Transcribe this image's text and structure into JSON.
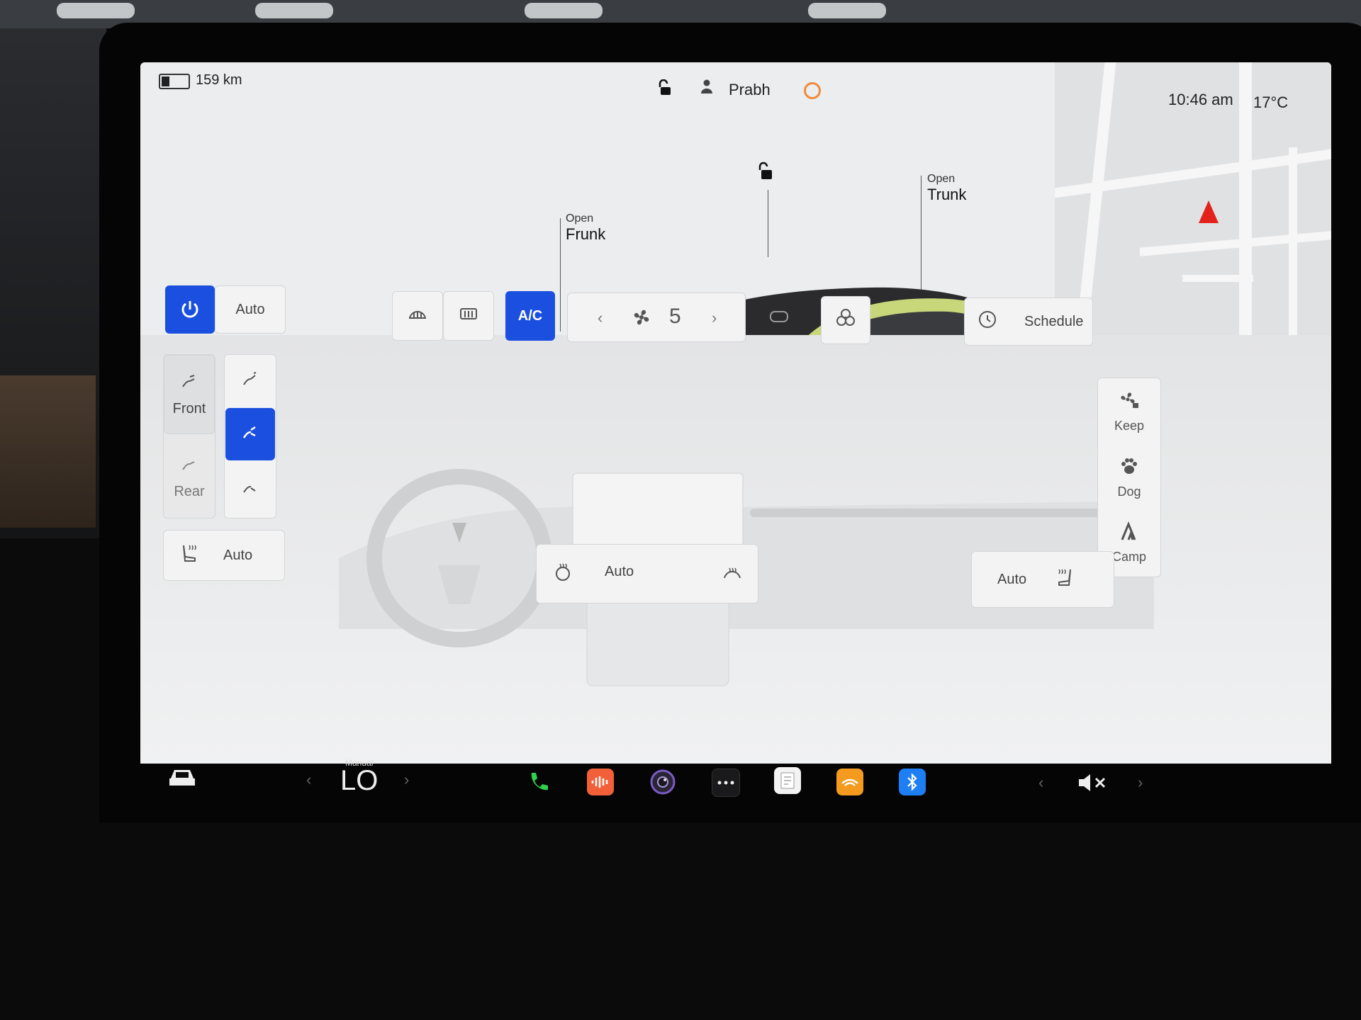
{
  "status": {
    "range": "159 km",
    "profile_name": "Prabh",
    "time": "10:46 am",
    "temperature": "17°C",
    "battery_level": 0.3
  },
  "car": {
    "frunk_state": "Open",
    "frunk_label": "Frunk",
    "trunk_state": "Open",
    "trunk_label": "Trunk"
  },
  "climate": {
    "auto_label": "Auto",
    "ac_label": "A/C",
    "fan_speed": "5",
    "schedule_label": "Schedule",
    "front_label": "Front",
    "rear_label": "Rear",
    "driver_seat_auto": "Auto",
    "steering_auto": "Auto",
    "passenger_seat_auto": "Auto",
    "modes": {
      "keep": "Keep",
      "dog": "Dog",
      "camp": "Camp"
    }
  },
  "taskbar": {
    "temp_mode": "Manual",
    "temp_value": "LO"
  },
  "colors": {
    "accent_blue": "#1a4fe0",
    "nav_red": "#e3221c",
    "alarm_orange": "#f08a3c"
  }
}
